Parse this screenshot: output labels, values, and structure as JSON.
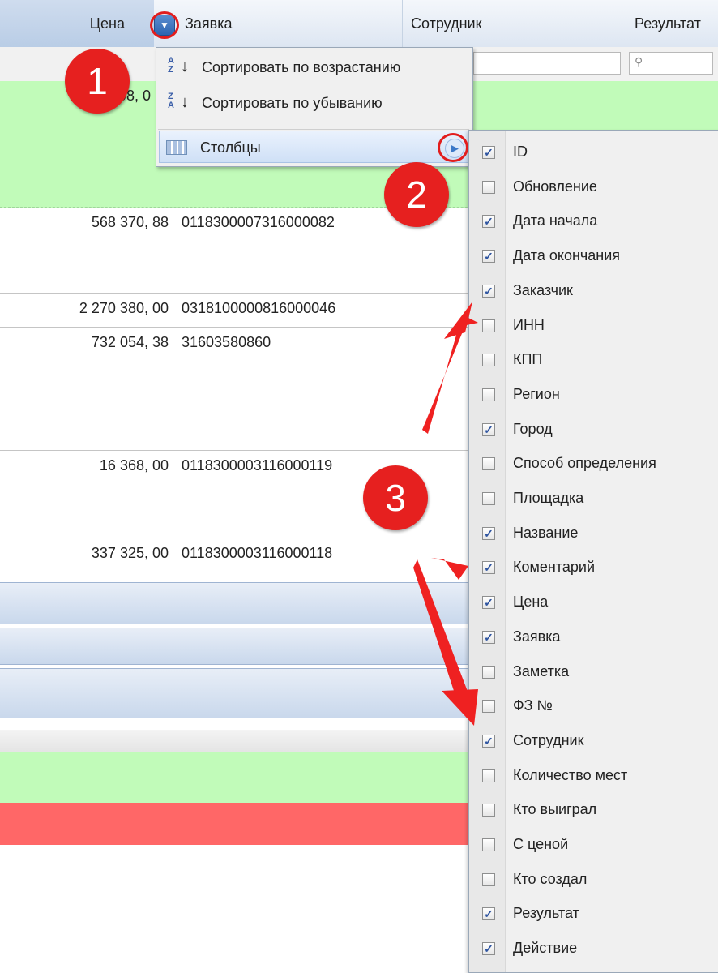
{
  "header": {
    "col_price": "Цена",
    "col_order": "Заявка",
    "col_employee": "Сотрудник",
    "col_result": "Результат",
    "trigger_icon": "dropdown-arrow-icon"
  },
  "rows": [
    {
      "price": "2 … 98, 0",
      "order": ""
    },
    {
      "price": "568 370, 88",
      "order": "0118300007316000082"
    },
    {
      "price": "2 270 380, 00",
      "order": "0318100000816000046"
    },
    {
      "price": "732 054, 38",
      "order": "31603580860"
    },
    {
      "price": "16 368, 00",
      "order": "0118300003116000119"
    },
    {
      "price": "337 325, 00",
      "order": "0118300003116000118"
    }
  ],
  "menu": {
    "sort_asc": "Сортировать по возрастанию",
    "sort_desc": "Сортировать по убыванию",
    "columns": "Столбцы"
  },
  "columns_menu": [
    {
      "label": "ID",
      "checked": true
    },
    {
      "label": "Обновление",
      "checked": false
    },
    {
      "label": "Дата начала",
      "checked": true
    },
    {
      "label": "Дата окончания",
      "checked": true
    },
    {
      "label": "Заказчик",
      "checked": true
    },
    {
      "label": "ИНН",
      "checked": false
    },
    {
      "label": "КПП",
      "checked": false
    },
    {
      "label": "Регион",
      "checked": false
    },
    {
      "label": "Город",
      "checked": true
    },
    {
      "label": "Способ определения",
      "checked": false
    },
    {
      "label": "Площадка",
      "checked": false
    },
    {
      "label": "Название",
      "checked": true
    },
    {
      "label": "Коментарий",
      "checked": true
    },
    {
      "label": "Цена",
      "checked": true
    },
    {
      "label": "Заявка",
      "checked": true
    },
    {
      "label": "Заметка",
      "checked": false
    },
    {
      "label": "ФЗ №",
      "checked": false
    },
    {
      "label": "Сотрудник",
      "checked": true
    },
    {
      "label": "Количество мест",
      "checked": false
    },
    {
      "label": "Кто выиграл",
      "checked": false
    },
    {
      "label": "С ценой",
      "checked": false
    },
    {
      "label": "Кто создал",
      "checked": false
    },
    {
      "label": "Результат",
      "checked": true
    },
    {
      "label": "Действие",
      "checked": true
    }
  ],
  "badges": {
    "b1": "1",
    "b2": "2",
    "b3": "3"
  },
  "colors": {
    "highlight_green": "#c1fbb9",
    "highlight_red": "#ff6767",
    "annotation_red": "#e6201f"
  }
}
